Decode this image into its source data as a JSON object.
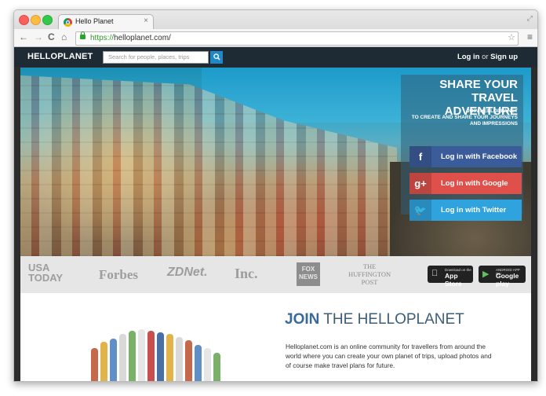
{
  "browser": {
    "tab_title": "Hello Planet",
    "tab_close": "×",
    "url_scheme": "https://",
    "url_rest": "helloplanet.com/",
    "nav_back": "←",
    "nav_forward": "→",
    "nav_reload": "C",
    "nav_home": "⌂",
    "star": "☆",
    "menu": "≡",
    "resize": "⤢"
  },
  "site": {
    "logo": "HELLOPLANET",
    "search_placeholder": "Search for people, places, trips",
    "search_icon": "search-icon",
    "login": "Log in",
    "or": "or",
    "signup": "Sign up"
  },
  "hero": {
    "headline_line1": "SHARE YOUR",
    "headline_line2": "TRAVEL ADVENTURE",
    "sub_line1": "JOIN HELLOPLANET",
    "sub_line2": "TO CREATE AND SHARE YOUR JOURNEYS",
    "sub_line3": "AND IMPRESSIONS",
    "buttons": [
      {
        "icon": "f",
        "label": "Log in with Facebook",
        "color": "#3b5c9a"
      },
      {
        "icon": "g+",
        "label": "Log in with Google",
        "color": "#e0504a"
      },
      {
        "icon": "🐦",
        "label": "Log in with Twitter",
        "color": "#2fa3de"
      }
    ]
  },
  "press": {
    "usatoday": "USA TODAY",
    "forbes": "Forbes",
    "zdnet": "ZDNet.",
    "inc": "Inc.",
    "foxnews": "FOX NEWS",
    "huffington_line1": "THE",
    "huffington_line2": "HUFFINGTON",
    "huffington_line3": "POST",
    "appstore_small": "Download on the",
    "appstore_big": "App Store",
    "googleplay_small": "ANDROID APP ON",
    "googleplay_big": "Google play"
  },
  "join": {
    "headline_bold": "JOIN",
    "headline_rest": " THE HELLOPLANET",
    "description": "Helloplanet.com is an online community for travellers from around the world where you can create your own planet of trips, upload photos and of course make travel plans for future."
  }
}
